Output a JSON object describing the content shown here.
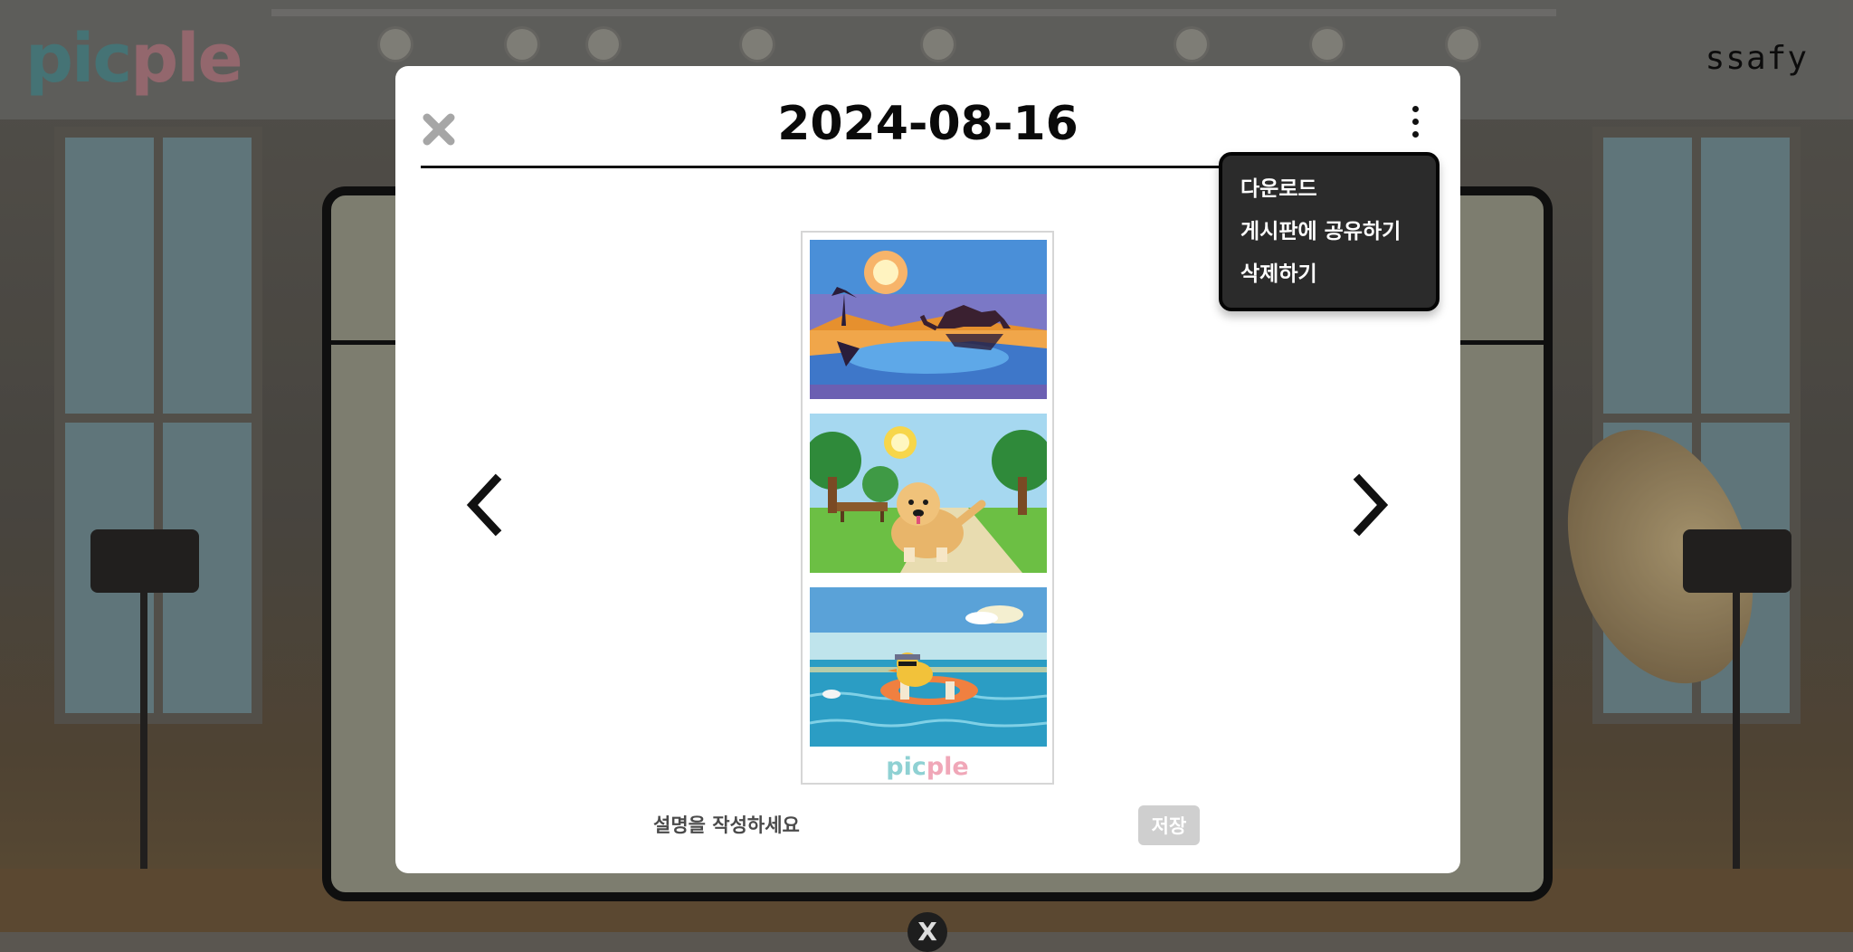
{
  "header": {
    "logo_part1": "pic",
    "logo_part2": "ple",
    "user_name": "ssafy"
  },
  "modal": {
    "title": "2024-08-16",
    "menu": {
      "items": [
        "다운로드",
        "게시판에 공유하기",
        "삭제하기"
      ]
    },
    "frame": {
      "photos": [
        "camel-oasis-pixel-art",
        "dog-park-pixel-art",
        "duck-sea-pixel-art"
      ],
      "brand_part1": "pic",
      "brand_part2": "ple"
    },
    "description": {
      "placeholder": "설명을 작성하세요",
      "value": ""
    },
    "save_label": "저장"
  },
  "background": {
    "close_glyph": "X"
  },
  "icons": {
    "close": "close-icon",
    "more": "more-vertical-icon",
    "prev": "chevron-left-icon",
    "next": "chevron-right-icon"
  },
  "colors": {
    "accent_teal": "#8fd1d3",
    "accent_pink": "#f0a7b8",
    "menu_bg": "#2b2b2b",
    "save_disabled": "#cfcfcf"
  }
}
